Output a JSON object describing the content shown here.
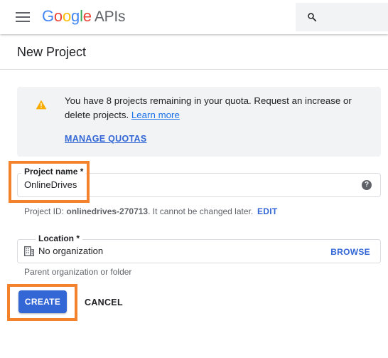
{
  "header": {
    "logo_google_letters": [
      "G",
      "o",
      "o",
      "g",
      "l",
      "e"
    ],
    "logo_colors": [
      "#4285f4",
      "#ea4335",
      "#fbbc05",
      "#4285f4",
      "#34a853",
      "#ea4335"
    ],
    "logo_suffix": "APIs",
    "menu_icon": "menu-icon",
    "search_icon": "search-icon"
  },
  "page": {
    "title": "New Project"
  },
  "quota": {
    "icon": "warning-icon",
    "icon_color": "#f9ab00",
    "message": "You have 8 projects remaining in your quota. Request an increase or delete projects. ",
    "learn_more": "Learn more",
    "manage_quotas": "MANAGE QUOTAS"
  },
  "project_name": {
    "label": "Project name *",
    "value": "OnlineDrives",
    "help_icon": "help-icon",
    "id_prefix": "Project ID: ",
    "id_value": "onlinedrives-270713",
    "id_suffix": ". It cannot be changed later.",
    "edit": "EDIT"
  },
  "location": {
    "label": "Location *",
    "icon": "organization-icon",
    "value": "No organization",
    "browse": "BROWSE",
    "hint": "Parent organization or folder"
  },
  "actions": {
    "create": "CREATE",
    "cancel": "CANCEL"
  },
  "colors": {
    "accent": "#3367d6",
    "link": "#1a73e8",
    "highlight": "#f4812c"
  }
}
